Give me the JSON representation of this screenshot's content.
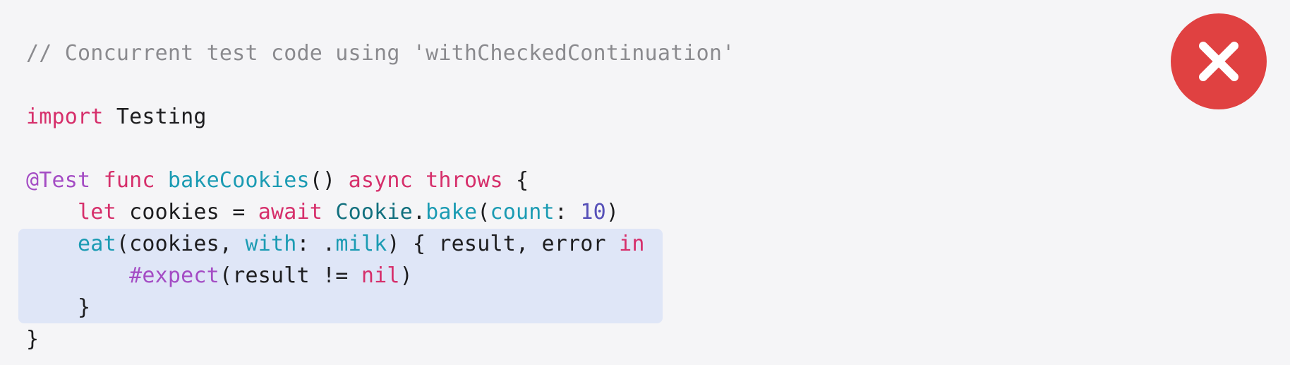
{
  "code": {
    "line1": {
      "comment": "// Concurrent test code using 'withCheckedContinuation'"
    },
    "line2": {
      "kw": "import",
      "sp": " ",
      "name": "Testing"
    },
    "line3": {
      "attr": "@Test",
      "sp1": " ",
      "kw1": "func",
      "sp2": " ",
      "fn": "bakeCookies",
      "punct1": "()",
      "sp3": " ",
      "kw2": "async",
      "sp4": " ",
      "kw3": "throws",
      "sp5": " ",
      "brace": "{"
    },
    "line4": {
      "indent": "    ",
      "kw1": "let",
      "plain1": " cookies = ",
      "kw2": "await",
      "sp": " ",
      "type": "Cookie",
      "dot": ".",
      "fn": "bake",
      "open": "(",
      "label": "count",
      "colon": ": ",
      "num": "10",
      "close": ")"
    },
    "line5": {
      "indent": "    ",
      "fn": "eat",
      "plain1": "(cookies, ",
      "label": "with",
      "colon": ": ",
      "dot": ".",
      "member": "milk",
      "plain2": ") { result, error ",
      "kw": "in"
    },
    "line6": {
      "indent": "        ",
      "macro": "#expect",
      "plain1": "(result != ",
      "kw": "nil",
      "close": ")"
    },
    "line7": {
      "indent": "    ",
      "brace": "}"
    },
    "line8": {
      "brace": "}"
    }
  },
  "status": {
    "icon": "error-x-icon",
    "color": "#e04141"
  }
}
